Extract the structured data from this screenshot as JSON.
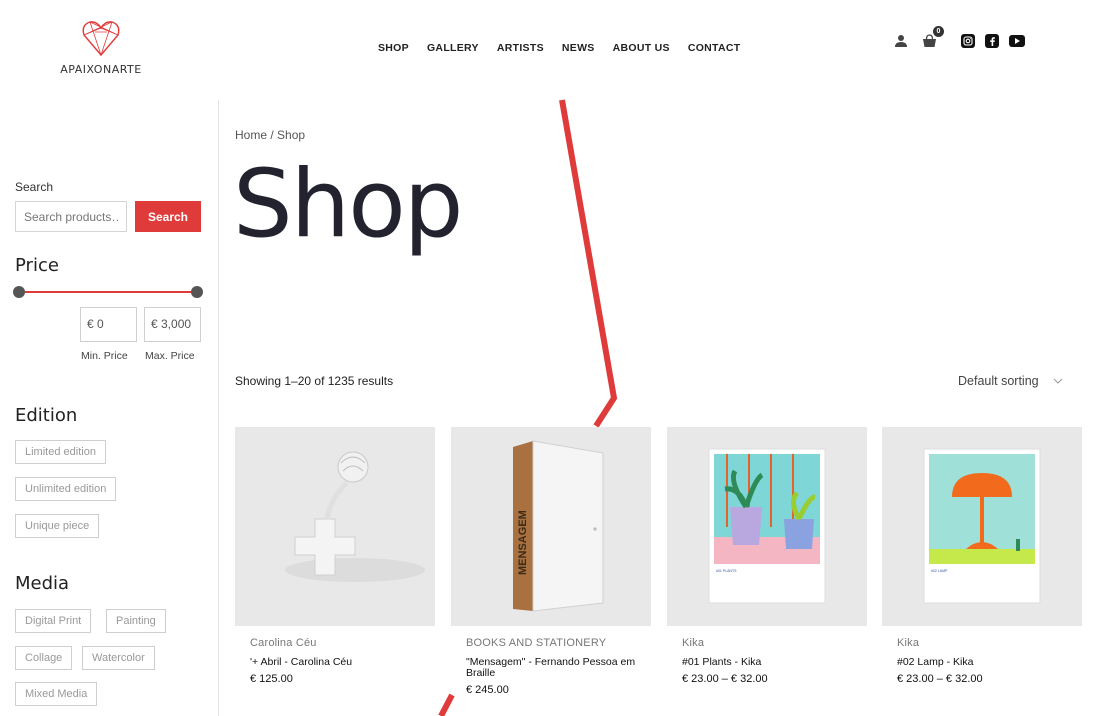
{
  "brand": {
    "logo_text": "APAIXONARTE"
  },
  "nav": {
    "items": [
      {
        "label": "SHOP"
      },
      {
        "label": "GALLERY"
      },
      {
        "label": "ARTISTS"
      },
      {
        "label": "NEWS"
      },
      {
        "label": "ABOUT US"
      },
      {
        "label": "CONTACT"
      }
    ]
  },
  "header": {
    "cart_count": "0",
    "icons": [
      "user-icon",
      "cart-icon",
      "instagram-icon",
      "facebook-icon",
      "youtube-icon"
    ]
  },
  "sidebar": {
    "search": {
      "label": "Search",
      "placeholder": "Search products…",
      "button": "Search"
    },
    "price": {
      "heading": "Price",
      "min_value": "€ 0",
      "max_value": "€ 3,000",
      "min_caption": "Min. Price",
      "max_caption": "Max. Price"
    },
    "edition": {
      "heading": "Edition",
      "options": [
        "Limited edition",
        "Unlimited edition",
        "Unique piece"
      ]
    },
    "media": {
      "heading": "Media",
      "options": [
        "Digital Print",
        "Painting",
        "Collage",
        "Watercolor",
        "Mixed Media"
      ]
    }
  },
  "main": {
    "breadcrumb": "Home / Shop",
    "title": "Shop",
    "results_text": "Showing 1–20 of 1235 results",
    "sorting": "Default sorting"
  },
  "products": [
    {
      "category": "Carolina Céu",
      "title": "'+ Abril - Carolina Céu",
      "price": "€ 125.00"
    },
    {
      "category": "BOOKS AND STATIONERY",
      "title": "\"Mensagem\" - Fernando Pessoa em Braille",
      "price": "€ 245.00",
      "book_spine_text": "MENSAGEM"
    },
    {
      "category": "Kika",
      "title": "#01 Plants - Kika",
      "price": "€ 23.00 – € 32.00",
      "print_caption": "#01 PLANTS"
    },
    {
      "category": "Kika",
      "title": "#02 Lamp - Kika",
      "price": "€ 23.00 – € 32.00",
      "print_caption": "#02 LAMP"
    }
  ],
  "colors": {
    "accent": "#e03b3b",
    "title": "#232330",
    "card_bg": "#e8e8e8"
  }
}
